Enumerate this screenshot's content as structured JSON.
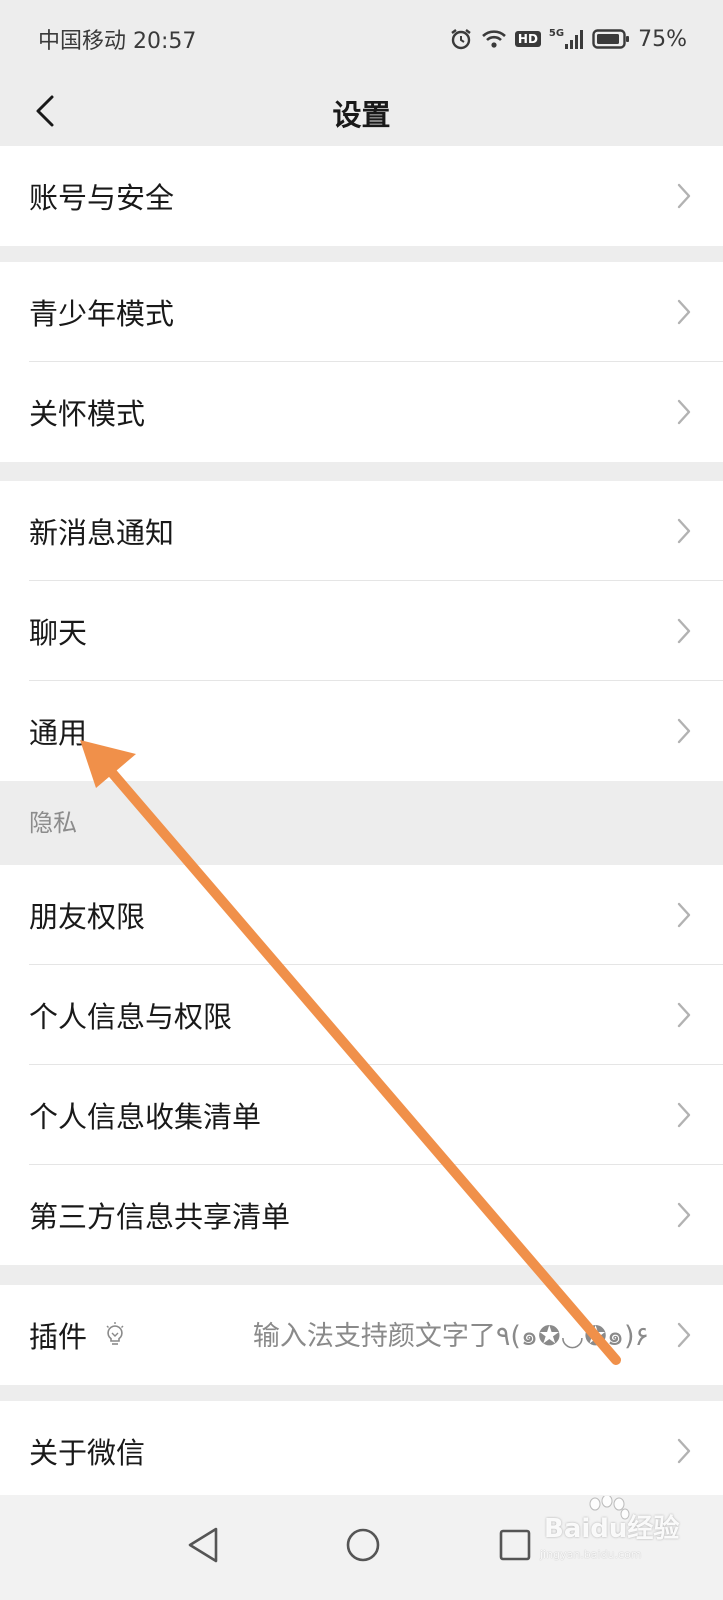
{
  "status_bar": {
    "carrier_time": "中国移动 20:57",
    "icons": [
      "alarm-icon",
      "wifi-icon",
      "hd-icon",
      "5g-signal-icon",
      "battery-icon"
    ],
    "hd_label": "HD",
    "network_label": "5G",
    "battery": "75%"
  },
  "nav": {
    "title": "设置",
    "back_icon": "chevron-left-icon"
  },
  "groups": {
    "g1": [
      "账号与安全"
    ],
    "g2": [
      "青少年模式",
      "关怀模式"
    ],
    "g3": [
      "新消息通知",
      "聊天",
      "通用"
    ],
    "privacy_header": "隐私",
    "g4": [
      "朋友权限",
      "个人信息与权限",
      "个人信息收集清单",
      "第三方信息共享清单"
    ],
    "plugin": {
      "label": "插件",
      "icon": "lightbulb-icon",
      "hint": "输入法支持颜文字了٩(๑✪◡✪๑)۶"
    },
    "g6": [
      "关于微信"
    ]
  },
  "bottom_nav": {
    "icons": [
      "back-triangle-icon",
      "home-circle-icon",
      "recents-square-icon"
    ]
  },
  "watermark": {
    "text": "Baidu经验",
    "sub": "jingyan.baidu.com"
  },
  "colors": {
    "background": "#ededed",
    "card": "#ffffff",
    "text": "#191919",
    "secondary_text": "#8c8c8c",
    "annotation_arrow": "#f0904a"
  }
}
